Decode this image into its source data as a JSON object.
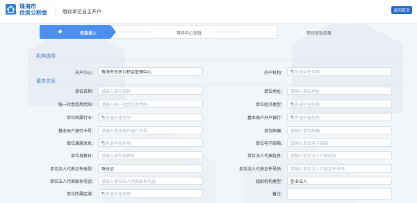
{
  "header": {
    "brand_line1": "珠海市",
    "brand_line2": "住房公积金",
    "title": "缴存单位自主开户",
    "back_label": "返回首页"
  },
  "steps": [
    {
      "label": "信息录入",
      "active": true
    },
    {
      "label": "等待中心审批",
      "active": false
    },
    {
      "label": "等待审批结果",
      "active": false
    }
  ],
  "sections": {
    "org_select": "机构选择",
    "basic_info": "基本信息"
  },
  "org": {
    "center_label": "开户中心：",
    "center_value": "珠海市住房公积金管理中心",
    "branch_label": "开户机构：",
    "branch_placeholder": "没有选中任何项"
  },
  "form": {
    "unit_name_label": "单位名称：",
    "unit_name_ph": "请输入单位名称",
    "unit_addr_label": "单位地址：",
    "unit_addr_ph": "请输入单位地址",
    "credit_code_label": "统一社会信用代码：",
    "credit_code_ph": "请输入统一社会信用代码",
    "econ_type_label": "单位经济类型：",
    "econ_type_ph": "没有选中任何项",
    "industry_label": "单位所属行业：",
    "industry_ph": "没有选中任何项",
    "bank_label": "基本账户开户银行：",
    "bank_ph": "没有选中任何项",
    "bank_acct_label": "基本账户银行卡号：",
    "bank_acct_ph": "请输入基本账户银行卡号",
    "postcode_label": "单位邮编：",
    "postcode_ph": "请输入单位邮编",
    "affil_label": "单位隶属关系：",
    "affil_ph": "没有选中任何项",
    "email_label": "单位电子邮箱：",
    "email_ph": "请输入单位电子邮箱",
    "payday_label": "单位发薪日：",
    "payday_ph": "请输入单位发薪日",
    "rep_name_label": "单位法人代表姓名：",
    "rep_name_ph": "请输入单位法人代表姓名",
    "rep_idtype_label": "单位法人代表证件类型：",
    "rep_idtype_value": "身份证",
    "rep_idno_label": "单位法人代表证件号码：",
    "rep_idno_ph": "请输入单位法人代表证件号码",
    "rep_phone_label": "单位法人代表联系电话：",
    "rep_phone_ph": "请输入单位法人代表联系电话",
    "org_type_label": "组织机构类型：",
    "org_type_value": "企业法人",
    "region_label": "单位所属区域：",
    "region_ph": "没有选中任何项",
    "remark_label": "备注："
  }
}
